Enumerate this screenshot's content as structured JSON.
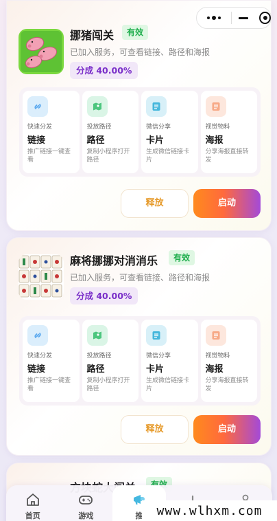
{
  "capsule": {
    "more_icon": "more-icon",
    "minimize_icon": "minimize-icon",
    "close_icon": "target-icon"
  },
  "cards": [
    {
      "title": "挪猪闯关",
      "status": "有效",
      "description": "已加入服务，可查看链接、路径和海报",
      "commission": "分成 40.00%",
      "tools": [
        {
          "category": "快速分发",
          "name": "链接",
          "sub": "推广链接一键查看",
          "icon": "link-icon"
        },
        {
          "category": "投放路径",
          "name": "路径",
          "sub": "复制小程序打开路径",
          "icon": "map-icon"
        },
        {
          "category": "微信分享",
          "name": "卡片",
          "sub": "生成微信链接卡片",
          "icon": "card-icon"
        },
        {
          "category": "视觉物料",
          "name": "海报",
          "sub": "分享海报直接转发",
          "icon": "poster-icon"
        }
      ],
      "release_label": "释放",
      "start_label": "启动"
    },
    {
      "title": "麻将挪挪对消消乐",
      "status": "有效",
      "description": "已加入服务，可查看链接、路径和海报",
      "commission": "分成 40.00%",
      "tools": [
        {
          "category": "快速分发",
          "name": "链接",
          "sub": "推广链接一键查看",
          "icon": "link-icon"
        },
        {
          "category": "投放路径",
          "name": "路径",
          "sub": "复制小程序打开路径",
          "icon": "map-icon"
        },
        {
          "category": "微信分享",
          "name": "卡片",
          "sub": "生成微信链接卡片",
          "icon": "card-icon"
        },
        {
          "category": "视觉物料",
          "name": "海报",
          "sub": "分享海报直接转发",
          "icon": "poster-icon"
        }
      ],
      "release_label": "释放",
      "start_label": "启动"
    },
    {
      "title": "方块蛇大闯关",
      "status": "有效"
    }
  ],
  "tabbar": {
    "tabs": [
      {
        "label": "首页",
        "icon": "home-icon"
      },
      {
        "label": "游戏",
        "icon": "gamepad-icon"
      },
      {
        "label": "推",
        "icon": "promote-icon",
        "active": true
      },
      {
        "label": "",
        "icon": "stats-icon"
      },
      {
        "label": "",
        "icon": "user-icon"
      }
    ]
  },
  "watermark": "www.wlhxm.com",
  "colors": {
    "badge_green": "#1fae4d",
    "commission_purple": "#7a2fc9",
    "release_orange": "#e69a2a",
    "start_gradient": [
      "#ff8a1d",
      "#a34ad8"
    ]
  }
}
